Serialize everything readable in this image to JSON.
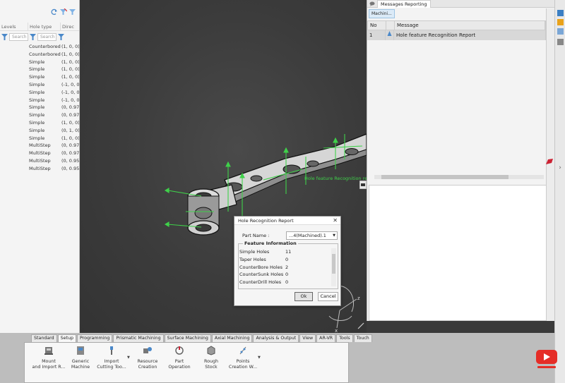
{
  "left_panel": {
    "columns": [
      "Levels",
      "Hole type",
      "Direc"
    ],
    "search_placeholder": "Search",
    "rows": [
      {
        "type": "Counterbored",
        "dir": "(1, 0, 0)"
      },
      {
        "type": "Counterbored",
        "dir": "(1, 0, 0)"
      },
      {
        "type": "Simple",
        "dir": "(1, 0, 0)"
      },
      {
        "type": "Simple",
        "dir": "(1, 0, 0)"
      },
      {
        "type": "Simple",
        "dir": "(1, 0, 0)"
      },
      {
        "type": "Simple",
        "dir": "(-1, 0, 0"
      },
      {
        "type": "Simple",
        "dir": "(-1, 0, 0"
      },
      {
        "type": "Simple",
        "dir": "(-1, 0, 0"
      },
      {
        "type": "Simple",
        "dir": "(0, 0.97("
      },
      {
        "type": "Simple",
        "dir": "(0, 0.97("
      },
      {
        "type": "Simple",
        "dir": "(1, 0, 0)"
      },
      {
        "type": "Simple",
        "dir": "(0, 1, 0)"
      },
      {
        "type": "Simple",
        "dir": "(1, 0, 0)"
      },
      {
        "type": "MultiStep",
        "dir": "(0, 0.97("
      },
      {
        "type": "MultiStep",
        "dir": "(0, 0.97("
      },
      {
        "type": "MultiStep",
        "dir": "(0, 0.95'"
      },
      {
        "type": "MultiStep",
        "dir": "(0, 0.95'"
      }
    ]
  },
  "messages": {
    "panel_title": "Messages Reporting",
    "filter_button": "Machini...",
    "col_no": "No",
    "col_message": "Message",
    "row": {
      "no": "1",
      "message": "Hole feature Recognition Report"
    }
  },
  "viewport": {
    "annotation": "Hole feature Recognition report(Machining)"
  },
  "dialog": {
    "title": "Hole Recognition Report",
    "part_label": "Part Name :",
    "part_value": "...4(Machined).1",
    "group_label": "Feature Information",
    "items": [
      {
        "label": "Simple Holes",
        "value": "11"
      },
      {
        "label": "Taper  Holes",
        "value": "0"
      },
      {
        "label": "CounterBore Holes",
        "value": "2"
      },
      {
        "label": "CounterSunk Holes",
        "value": "0"
      },
      {
        "label": "CounterDrill Holes",
        "value": "0"
      }
    ],
    "ok_label": "Ok",
    "cancel_label": "Cancel"
  },
  "ribbon": {
    "tabs": [
      "Standard",
      "Setup",
      "Programming",
      "Prismatic Machining",
      "Surface Machining",
      "Axial Machining",
      "Analysis & Output",
      "View",
      "AR-VR",
      "Tools",
      "Touch"
    ],
    "active_tab": "Setup",
    "buttons": [
      {
        "line1": "Mount",
        "line2": "and Import R..."
      },
      {
        "line1": "Generic",
        "line2": "Machine"
      },
      {
        "line1": "Import",
        "line2": "Cutting Too..."
      },
      {
        "line1": "Resource",
        "line2": "Creation"
      },
      {
        "line1": "Part",
        "line2": "Operation"
      },
      {
        "line1": "Rough",
        "line2": "Stock"
      },
      {
        "line1": "Points",
        "line2": "Creation W..."
      }
    ]
  },
  "compass": {
    "x": "x",
    "z": "z"
  },
  "colors": {
    "accent_green": "#3fd14a",
    "youtube_red": "#e52d27"
  }
}
